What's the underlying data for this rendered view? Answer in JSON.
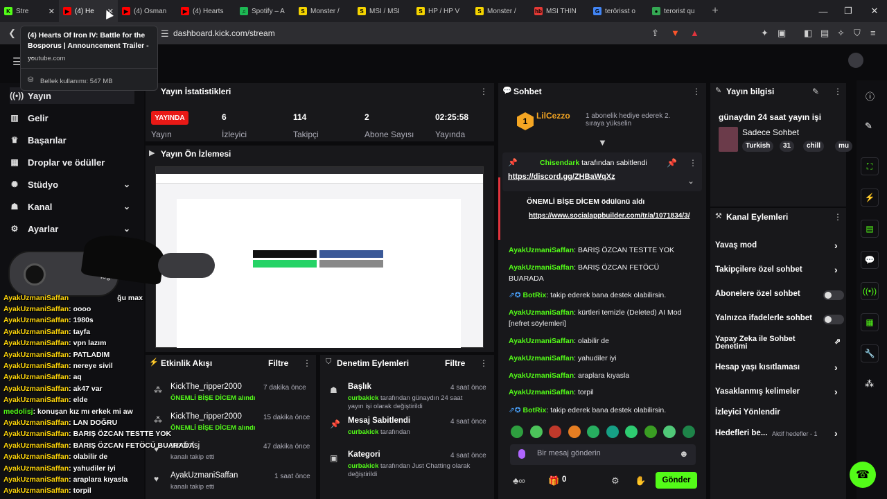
{
  "tabs": [
    {
      "label": "Stre",
      "color": "#53fc18",
      "glyph": "K"
    },
    {
      "label": "(4) He",
      "color": "#ff0000",
      "glyph": "▶",
      "active": true
    },
    {
      "label": "(4) Osman",
      "color": "#ff0000",
      "glyph": "▶"
    },
    {
      "label": "(4) Hearts",
      "color": "#ff0000",
      "glyph": "▶"
    },
    {
      "label": "Spotify – A",
      "color": "#1db954",
      "glyph": "♫"
    },
    {
      "label": "Monster /",
      "color": "#f5d400",
      "glyph": "S"
    },
    {
      "label": "MSI / MSI",
      "color": "#f5d400",
      "glyph": "S"
    },
    {
      "label": "HP / HP V",
      "color": "#f5d400",
      "glyph": "S"
    },
    {
      "label": "Monster /",
      "color": "#f5d400",
      "glyph": "S"
    },
    {
      "label": "MSI THIN",
      "color": "#e53935",
      "glyph": "hb"
    },
    {
      "label": "terörisst o",
      "color": "#4285f4",
      "glyph": "G"
    },
    {
      "label": "terorist qu",
      "color": "#34a853",
      "glyph": "●"
    }
  ],
  "browser": {
    "url": "dashboard.kick.com/stream"
  },
  "tooltip": {
    "title": "(4) Hearts Of Iron IV: Battle for the Bosporus | Announcement Trailer - ...",
    "domain": "youtube.com",
    "memory": "Bellek kullanımı: 547 MB"
  },
  "sidebar": {
    "items": [
      {
        "label": "Yayın",
        "icon": "broadcast-icon"
      },
      {
        "label": "Gelir",
        "icon": "revenue-icon"
      },
      {
        "label": "Başarılar",
        "icon": "trophy-icon"
      },
      {
        "label": "Droplar ve ödüller",
        "icon": "gift-icon"
      },
      {
        "label": "Stüdyo",
        "icon": "palette-icon"
      },
      {
        "label": "Kanal",
        "icon": "users-icon"
      },
      {
        "label": "Ayarlar",
        "icon": "gear-icon"
      }
    ]
  },
  "stats": {
    "title": "Yayın İstatistikleri",
    "live_badge": "YAYINDA",
    "live_label": "Yayın",
    "viewers": "6",
    "viewers_label": "İzleyici",
    "followers": "114",
    "followers_label": "Takipçi",
    "subs": "2",
    "subs_label": "Abone Sayısı",
    "uptime": "02:25:58",
    "uptime_label": "Yayında"
  },
  "preview": {
    "title": "Yayın Ön İzlemesi"
  },
  "activity": {
    "title": "Etkinlik Akışı",
    "filter": "Filtre",
    "items": [
      {
        "user": "KickThe_ripper2000",
        "sub": "ÖNEMLİ BİŞE DİCEM alındı",
        "time": "7 dakika önce"
      },
      {
        "user": "KickThe_ripper2000",
        "sub": "ÖNEMLİ BİŞE DİCEM alındı",
        "time": "15 dakika önce"
      },
      {
        "user": "mediolsj",
        "sub": "kanalı takip etti",
        "time": "47 dakika önce"
      },
      {
        "user": "AyakUzmaniSaffan",
        "sub": "kanalı takip etti",
        "time": "1 saat önce"
      }
    ]
  },
  "moderation": {
    "title": "Denetim Eylemleri",
    "filter": "Filtre",
    "items": [
      {
        "title": "Başlık",
        "actor": "curbakick",
        "rest": "tarafından günaydın 24 saat yayın işi olarak değiştirildi",
        "time": "4 saat önce"
      },
      {
        "title": "Mesaj Sabitlendi",
        "actor": "curbakick",
        "rest": "tarafından",
        "time": "4 saat önce"
      },
      {
        "title": "Kategori",
        "actor": "curbakick",
        "rest": "tarafından Just Chatting olarak değiştirildi",
        "time": "4 saat önce"
      }
    ]
  },
  "chat": {
    "title": "Sohbet",
    "top_user": "LilCezzo",
    "top_rank": "1",
    "top_note": "1 abonelik hediye ederek 2. sıraya yükselin",
    "pinned_by": "Chisendark",
    "pinned_suffix": "tarafından sabitlendi",
    "pinned_link": "https://discord.gg/ZHBaWqXz",
    "reward_text": "ÖNEMLİ BİŞE DİCEM ödülünü aldı",
    "reward_link": "https://www.socialappbuilder.com/tr/a/1071834/3/",
    "messages": [
      {
        "user": "AyakUzmaniSaffan",
        "text": "BARIŞ ÖZCAN TESTTE YOK"
      },
      {
        "user": "AyakUzmaniSaffan",
        "text": "BARIŞ ÖZCAN FETÖCÜ BUARADA"
      },
      {
        "user": "BotRix",
        "text": "takip ederek bana destek olabilirsin."
      },
      {
        "user": "AyakUzmaniSaffan",
        "text": "kürtleri temizle (Deleted) AI Mod [nefret söylemleri]"
      },
      {
        "user": "AyakUzmaniSaffan",
        "text": "olabilir de"
      },
      {
        "user": "AyakUzmaniSaffan",
        "text": "yahudiler iyi"
      },
      {
        "user": "AyakUzmaniSaffan",
        "text": "araplara kıyasla"
      },
      {
        "user": "AyakUzmaniSaffan",
        "text": "torpil"
      },
      {
        "user": "BotRix",
        "text": "takip ederek bana destek olabilirsin."
      }
    ],
    "placeholder": "Bir mesaj gönderin",
    "count": "0",
    "send": "Gönder"
  },
  "info": {
    "title": "Yayın bilgisi",
    "stream_title": "günaydın 24 saat yayın işi",
    "category": "Sadece Sohbet",
    "tags": [
      "Turkish",
      "31",
      "chill",
      "mu"
    ]
  },
  "channel_actions": {
    "title": "Kanal Eylemleri",
    "items": [
      {
        "label": "Yavaş mod",
        "control": "chevron"
      },
      {
        "label": "Takipçilere özel sohbet",
        "control": "chevron"
      },
      {
        "label": "Abonelere özel sohbet",
        "control": "toggle"
      },
      {
        "label": "Yalnızca ifadelerle sohbet",
        "control": "toggle"
      },
      {
        "label": "Yapay Zeka ile Sohbet Denetimi",
        "control": "external"
      },
      {
        "label": "Hesap yaşı kısıtlaması",
        "control": "chevron"
      },
      {
        "label": "Yasaklanmış kelimeler",
        "control": "chevron"
      },
      {
        "label": "İzleyici Yönlendir",
        "control": "none"
      },
      {
        "label": "Hedefleri be...",
        "control": "chevron",
        "extra": "Aktif hedefler - 1"
      }
    ]
  },
  "overlay_chat": [
    {
      "user": "AyakUzmaniSaffan",
      "text": "oooo"
    },
    {
      "user": "AyakUzmaniSaffan",
      "text": "1980s"
    },
    {
      "user": "AyakUzmaniSaffan",
      "text": "tayfa"
    },
    {
      "user": "AyakUzmaniSaffan",
      "text": "vpn lazım"
    },
    {
      "user": "AyakUzmaniSaffan",
      "text": "PATLADIM"
    },
    {
      "user": "AyakUzmaniSaffan",
      "text": "nereye sivil"
    },
    {
      "user": "AyakUzmaniSaffan",
      "text": "aq"
    },
    {
      "user": "AyakUzmaniSaffan",
      "text": "ak47 var"
    },
    {
      "user": "AyakUzmaniSaffan",
      "text": "elde"
    },
    {
      "user": "medolisj",
      "text": "konuşan kız mı erkek mi aw"
    },
    {
      "user": "AyakUzmaniSaffan",
      "text": "LAN DOĞRU"
    },
    {
      "user": "AyakUzmaniSaffan",
      "text": "BARIŞ ÖZCAN TESTTE YOK"
    },
    {
      "user": "AyakUzmaniSaffan",
      "text": "BARIŞ ÖZCAN FETÖCÜ BUARADA"
    },
    {
      "user": "AyakUzmaniSaffan",
      "text": "olabilir de"
    },
    {
      "user": "AyakUzmaniSaffan",
      "text": "yahudiler iyi"
    },
    {
      "user": "AyakUzmaniSaffan",
      "text": "araplara kıyasla"
    },
    {
      "user": "AyakUzmaniSaffan",
      "text": "torpil"
    }
  ],
  "overlay_extra": {
    "u0": "AyakUzmaniSaffan",
    "t0": "ğu max",
    "logo": "logi"
  }
}
